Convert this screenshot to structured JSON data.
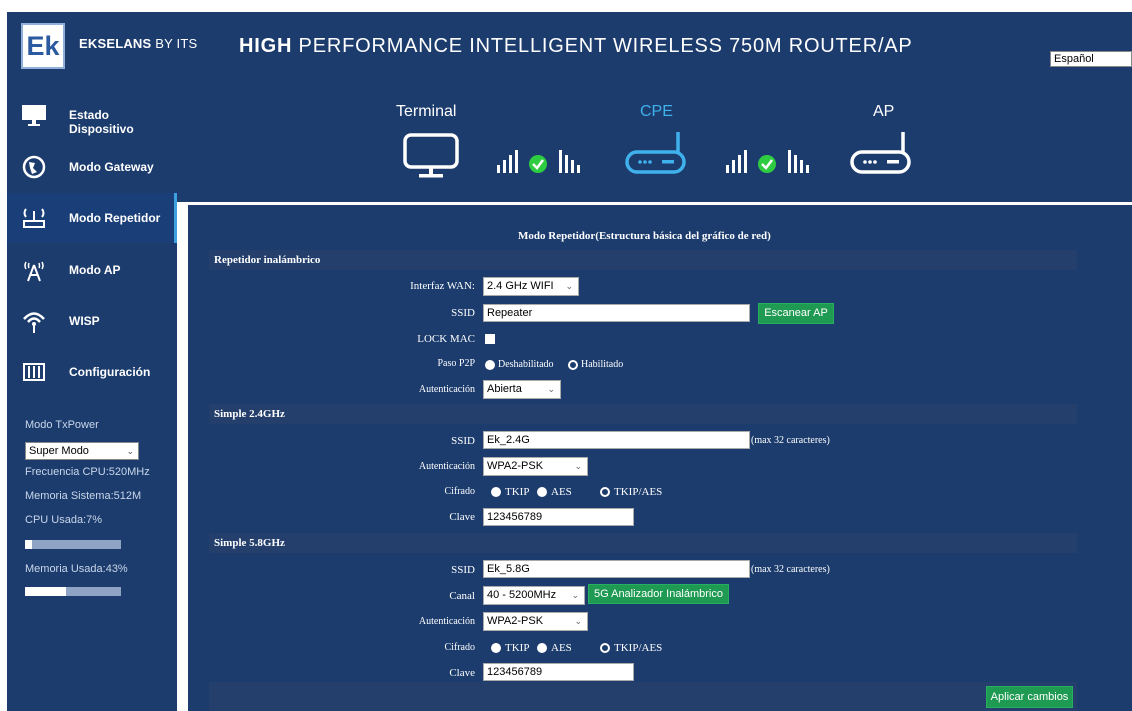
{
  "header": {
    "logo": "Ek",
    "brand": "EKSELANS",
    "brand_by": " BY ITS",
    "product_bold": "HIGH",
    "product": " PERFORMANCE  INTELLIGENT  WIRELESS  750M    ROUTER/AP",
    "language": "Español"
  },
  "sidebar": {
    "items": [
      {
        "label": "Estado Dispositivo",
        "icon": "monitor-icon"
      },
      {
        "label": "Modo Gateway",
        "icon": "globe-icon"
      },
      {
        "label": "Modo Repetidor",
        "icon": "repeater-icon"
      },
      {
        "label": "Modo AP",
        "icon": "antenna-icon"
      },
      {
        "label": "WISP",
        "icon": "wifi-tower-icon"
      },
      {
        "label": "Configuración",
        "icon": "settings-grid-icon"
      }
    ],
    "active_index": 2,
    "txpower_label": "Modo TxPower",
    "txpower_value": "Super Modo",
    "cpu_freq": "Frecuencia CPU:520MHz",
    "memory": "Memoria Sistema:512M",
    "cpu_used": "CPU Usada:7%",
    "cpu_used_fraction": 0.07,
    "memory_used": "Memoria Usada:43%",
    "memory_used_fraction": 0.43
  },
  "topology": {
    "terminal": "Terminal",
    "cpe": "CPE",
    "ap": "AP",
    "accent": "#3fb1ec",
    "ok_color": "#2ecc40"
  },
  "main": {
    "title": "Modo Repetidor(Estructura básica del gráfico de red)",
    "repeater": {
      "section": "Repetidor inalámbrico",
      "wan_label": "Interfaz WAN:",
      "wan_value": "2.4 GHz WIFI",
      "ssid_label": "SSID",
      "ssid_value": "Repeater",
      "scan_button": "Escanear AP",
      "lockmac_label": "LOCK MAC",
      "p2p_label": "Paso P2P",
      "p2p_options": [
        "Deshabilitado",
        "Habilitado"
      ],
      "p2p_selected": "Habilitado",
      "auth_label": "Autenticación",
      "auth_value": "Abierta"
    },
    "band24": {
      "section": "Simple 2.4GHz",
      "ssid_label": "SSID",
      "ssid_value": "Ek_2.4G",
      "ssid_note": "(max 32 caracteres)",
      "auth_label": "Autenticación",
      "auth_value": "WPA2-PSK",
      "cipher_label": "Cifrado",
      "cipher_options": [
        "TKIP",
        "AES",
        "TKIP/AES"
      ],
      "cipher_selected": "TKIP/AES",
      "key_label": "Clave",
      "key_value": "123456789"
    },
    "band58": {
      "section": "Simple 5.8GHz",
      "ssid_label": "SSID",
      "ssid_value": "Ek_5.8G",
      "ssid_note": "(max 32 caracteres)",
      "channel_label": "Canal",
      "channel_value": "40 - 5200MHz",
      "analyzer_button": "5G Analizador Inalámbrico",
      "auth_label": "Autenticación",
      "auth_value": "WPA2-PSK",
      "cipher_label": "Cifrado",
      "cipher_options": [
        "TKIP",
        "AES",
        "TKIP/AES"
      ],
      "cipher_selected": "TKIP/AES",
      "key_label": "Clave",
      "key_value": "123456789"
    },
    "apply_button": "Aplicar cambios"
  }
}
